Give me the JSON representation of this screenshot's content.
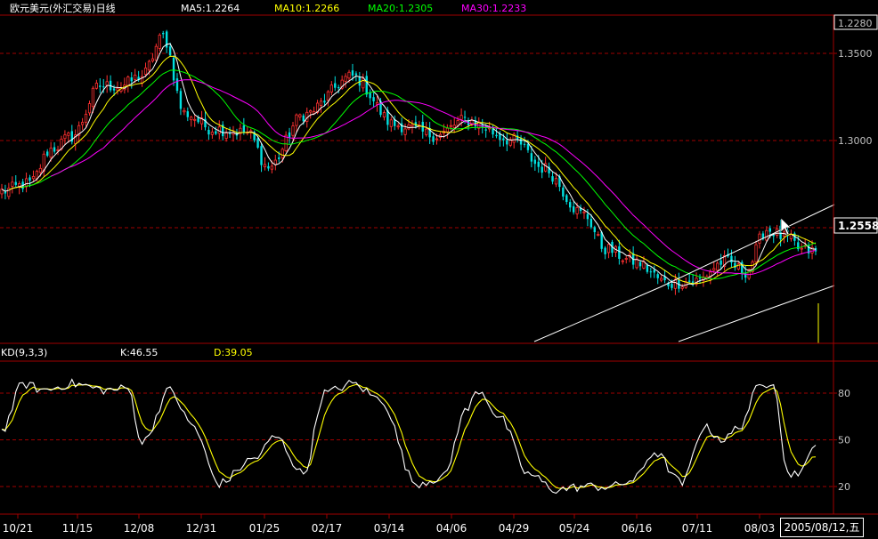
{
  "header": {
    "title": "欧元美元(外汇交易)日线",
    "ma5": "MA5:1.2264",
    "ma10": "MA10:1.2266",
    "ma20": "MA20:1.2305",
    "ma30": "MA30:1.2233"
  },
  "kd_header": {
    "label": "KD(9,3,3)",
    "k": "K:46.55",
    "d": "D:39.05"
  },
  "date_box": "2005/08/12,五",
  "colors": {
    "up": "#ff3030",
    "down": "#00e0e0",
    "ma5": "#ffffff",
    "ma10": "#ffff00",
    "ma20": "#00ff00",
    "ma30": "#ff00ff",
    "grid": "#a00000",
    "axis": "#a00000",
    "k_line": "#ffffff",
    "d_line": "#ffff00"
  },
  "chart_data": {
    "type": "candlestick",
    "y_ticks": [
      "1.2280",
      "1.3500",
      "1.3000",
      "1.2558"
    ],
    "kd_ticks": [
      "80",
      "50",
      "20"
    ],
    "x_ticks": [
      "10/21",
      "11/15",
      "12/08",
      "12/31",
      "01/25",
      "02/17",
      "03/14",
      "04/06",
      "04/29",
      "05/24",
      "06/16",
      "07/11",
      "08/03"
    ],
    "price_range": [
      1.1675,
      1.3773
    ],
    "close_anchors": [
      [
        0,
        1.265
      ],
      [
        8,
        1.27
      ],
      [
        14,
        1.292
      ],
      [
        20,
        1.3
      ],
      [
        28,
        1.3325
      ],
      [
        34,
        1.3325
      ],
      [
        40,
        1.339
      ],
      [
        46,
        1.364
      ],
      [
        52,
        1.315
      ],
      [
        60,
        1.305
      ],
      [
        70,
        1.3025
      ],
      [
        76,
        1.28
      ],
      [
        86,
        1.314
      ],
      [
        100,
        1.3385
      ],
      [
        112,
        1.3075
      ],
      [
        124,
        1.3007
      ],
      [
        132,
        1.3105
      ],
      [
        146,
        1.2975
      ],
      [
        154,
        1.28
      ],
      [
        166,
        1.25
      ],
      [
        172,
        1.228
      ],
      [
        180,
        1.22
      ],
      [
        190,
        1.206
      ],
      [
        198,
        1.2075
      ],
      [
        206,
        1.22
      ],
      [
        212,
        1.2135
      ],
      [
        218,
        1.2405
      ],
      [
        224,
        1.2345
      ],
      [
        228,
        1.227
      ],
      [
        232,
        1.2264
      ]
    ],
    "k_anchors": [
      [
        0,
        56
      ],
      [
        6,
        86
      ],
      [
        12,
        82
      ],
      [
        20,
        86
      ],
      [
        30,
        82
      ],
      [
        36,
        83
      ],
      [
        40,
        48
      ],
      [
        48,
        82
      ],
      [
        54,
        60
      ],
      [
        62,
        22
      ],
      [
        72,
        38
      ],
      [
        78,
        52
      ],
      [
        86,
        28
      ],
      [
        92,
        80
      ],
      [
        100,
        86
      ],
      [
        108,
        76
      ],
      [
        118,
        22
      ],
      [
        126,
        26
      ],
      [
        132,
        68
      ],
      [
        136,
        82
      ],
      [
        142,
        64
      ],
      [
        150,
        28
      ],
      [
        158,
        18
      ],
      [
        166,
        20
      ],
      [
        174,
        20
      ],
      [
        180,
        24
      ],
      [
        186,
        42
      ],
      [
        194,
        22
      ],
      [
        200,
        58
      ],
      [
        206,
        50
      ],
      [
        210,
        58
      ],
      [
        216,
        84
      ],
      [
        220,
        88
      ],
      [
        224,
        28
      ],
      [
        228,
        30
      ],
      [
        232,
        46.55
      ]
    ]
  }
}
